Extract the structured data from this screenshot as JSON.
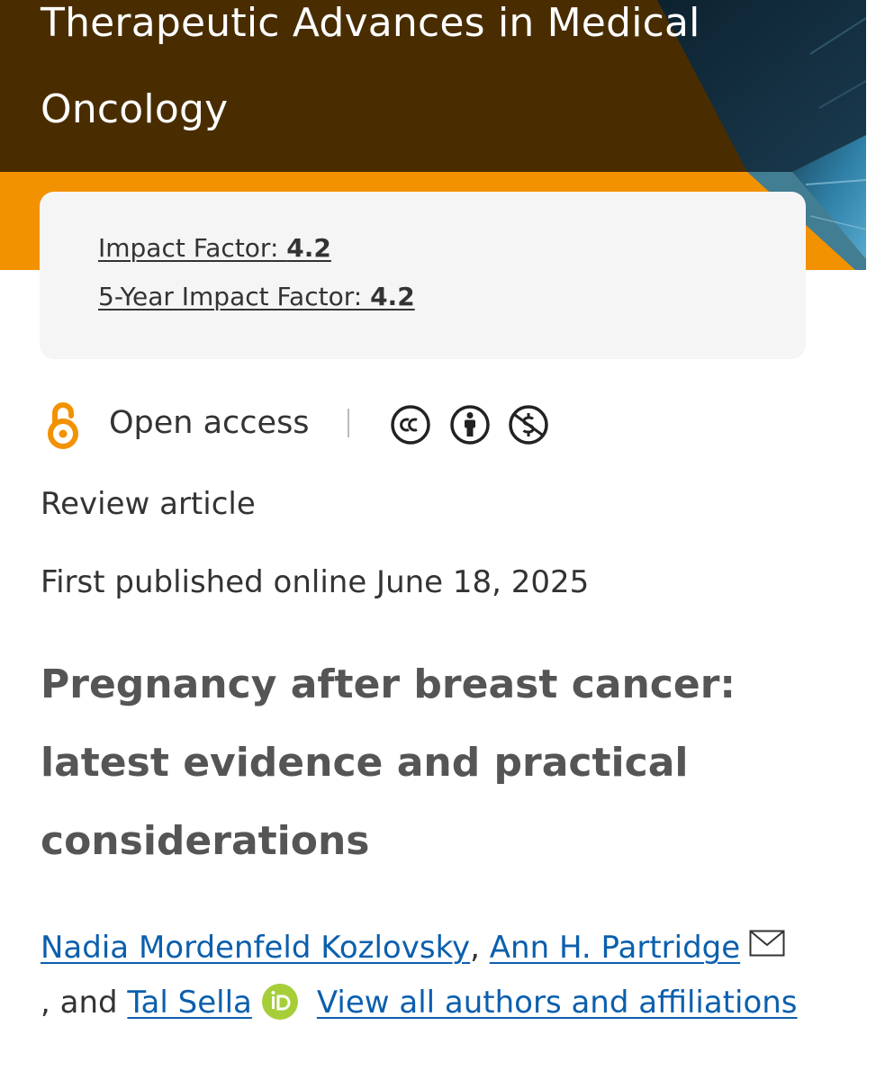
{
  "journal": {
    "title": "Therapeutic Advances in Medical Oncology",
    "colors": {
      "banner_dark": "#492d00",
      "banner_accent": "#f29200",
      "art_blue": "#3a8fb4"
    }
  },
  "impact": {
    "impact_factor_label": "Impact Factor: ",
    "impact_factor_value": "4.2",
    "five_year_label": "5-Year Impact Factor: ",
    "five_year_value": "4.2"
  },
  "access": {
    "label": "Open access",
    "open_access_icon": "open-lock-icon",
    "licenses": [
      "creative-commons-icon",
      "attribution-icon",
      "non-commercial-icon"
    ],
    "icon_color": "#f29200"
  },
  "article": {
    "type": "Review article",
    "published": "First published online June 18, 2025",
    "title": "Pregnancy after breast cancer: latest evidence and practical considerations"
  },
  "authors": {
    "author1": "Nadia Mordenfeld Kozlovsky",
    "sep1": ",",
    "author2": "Ann H. Partridge",
    "sep2": ", and",
    "author3": "Tal Sella",
    "view_all": "View all authors and affiliations",
    "link_color": "#0b5fad",
    "orcid_color": "#a6ce39"
  }
}
